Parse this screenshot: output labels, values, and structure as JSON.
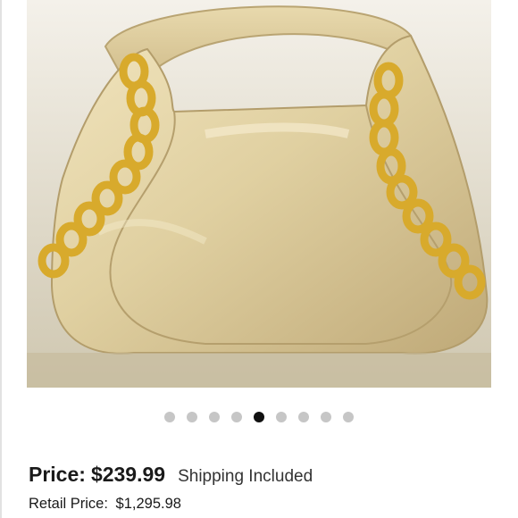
{
  "product": {
    "image_alt": "Gold metallic leather hobo bag with gold chain detail",
    "colors": {
      "leather": "#e2d3a6",
      "chain": "#d8aa2c",
      "background": "#ddd6c2"
    }
  },
  "carousel": {
    "dot_count": 9,
    "active_index": 4,
    "colors": {
      "inactive": "#c6c6c6",
      "active": "#111111"
    }
  },
  "pricing": {
    "price_label": "Price:",
    "price_value": "$239.99",
    "shipping_text": "Shipping Included",
    "retail_label": "Retail Price:",
    "retail_value": "$1,295.98"
  }
}
